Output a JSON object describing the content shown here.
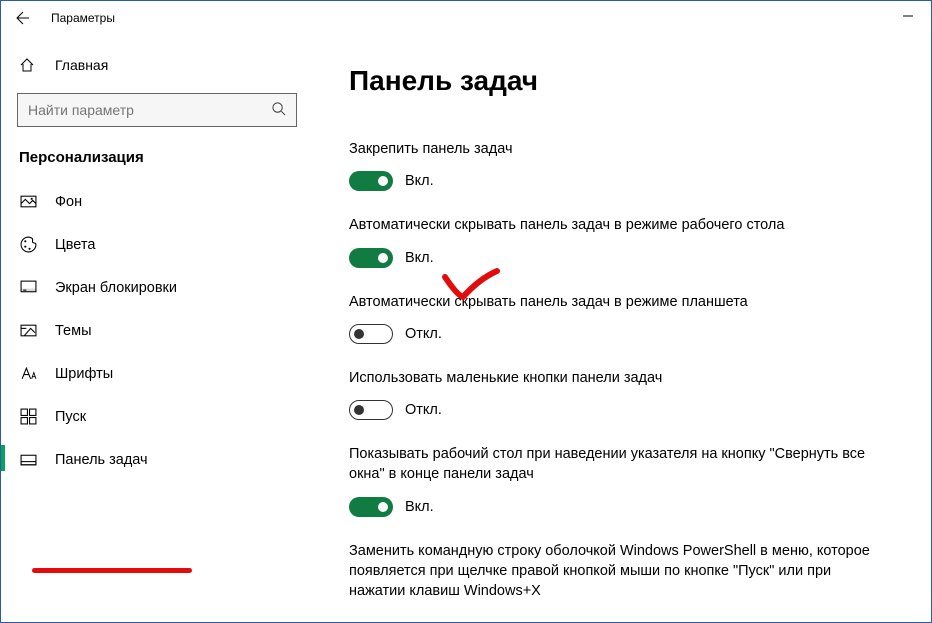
{
  "window": {
    "title": "Параметры"
  },
  "sidebar": {
    "home": "Главная",
    "search_placeholder": "Найти параметр",
    "category": "Персонализация",
    "items": [
      {
        "label": "Фон"
      },
      {
        "label": "Цвета"
      },
      {
        "label": "Экран блокировки"
      },
      {
        "label": "Темы"
      },
      {
        "label": "Шрифты"
      },
      {
        "label": "Пуск"
      },
      {
        "label": "Панель задач"
      }
    ]
  },
  "content": {
    "title": "Панель задач",
    "settings": [
      {
        "label": "Закрепить панель задач",
        "state": "Вкл.",
        "on": true
      },
      {
        "label": "Автоматически скрывать панель задач в режиме рабочего стола",
        "state": "Вкл.",
        "on": true
      },
      {
        "label": "Автоматически скрывать панель задач в режиме планшета",
        "state": "Откл.",
        "on": false
      },
      {
        "label": "Использовать маленькие кнопки панели задач",
        "state": "Откл.",
        "on": false
      },
      {
        "label": "Показывать рабочий стол при наведении указателя на кнопку \"Свернуть все окна\" в конце панели задач",
        "state": "Вкл.",
        "on": true
      },
      {
        "label": "Заменить командную строку оболочкой Windows PowerShell в меню, которое появляется при щелчке правой кнопкой мыши по кнопке \"Пуск\" или при нажатии клавиш Windows+X",
        "state": "",
        "on": null
      }
    ]
  }
}
